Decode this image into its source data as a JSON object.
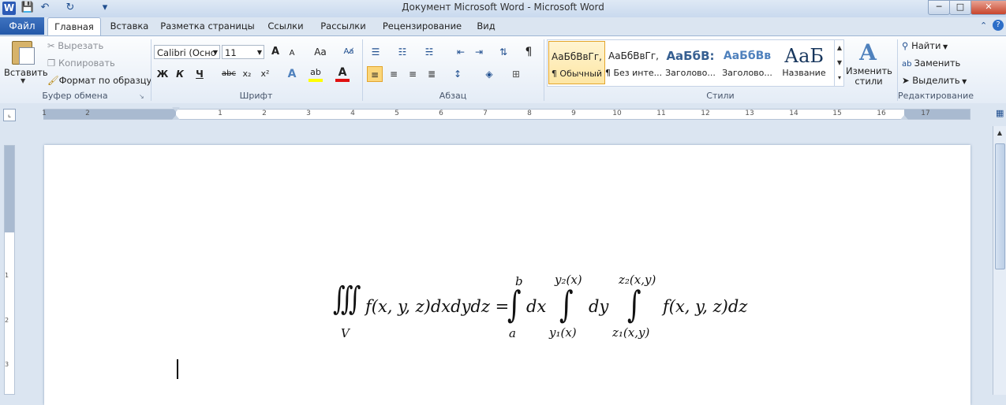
{
  "window": {
    "title": "Документ Microsoft Word  -  Microsoft Word",
    "logo": "W",
    "controls": {
      "minimize": "─",
      "maximize": "□",
      "close": "✕"
    }
  },
  "qat": {
    "save_icon": "💾",
    "undo_icon": "↶",
    "redo_icon": "↻",
    "customize_icon": "▾"
  },
  "tabs": [
    {
      "label": "Файл"
    },
    {
      "label": "Главная"
    },
    {
      "label": "Вставка"
    },
    {
      "label": "Разметка страницы"
    },
    {
      "label": "Ссылки"
    },
    {
      "label": "Рассылки"
    },
    {
      "label": "Рецензирование"
    },
    {
      "label": "Вид"
    }
  ],
  "clipboard": {
    "paste": "Вставить",
    "cut": "Вырезать",
    "copy": "Копировать",
    "format_painter": "Формат по образцу",
    "group": "Буфер обмена"
  },
  "font": {
    "name": "Calibri (Осно",
    "size": "11",
    "grow": "A",
    "shrink": "A",
    "change_case": "Aa",
    "bold": "Ж",
    "italic": "К",
    "underline": "Ч",
    "strike": "abc",
    "subscript": "x₂",
    "superscript": "x²",
    "group": "Шрифт",
    "highlight_color": "#ffff00",
    "font_color": "#e01010"
  },
  "paragraph": {
    "group": "Абзац",
    "pilcrow": "¶"
  },
  "styles": {
    "group": "Стили",
    "items": [
      {
        "preview": "АаБбВвГг,",
        "name": "¶ Обычный"
      },
      {
        "preview": "АаБбВвГг,",
        "name": "¶ Без инте..."
      },
      {
        "preview": "АаБбВ:",
        "name": "Заголово..."
      },
      {
        "preview": "АаБбВв",
        "name": "Заголово..."
      },
      {
        "preview": "АаБ",
        "name": "Название"
      }
    ],
    "change_styles": "Изменить стили"
  },
  "editing": {
    "group": "Редактирование",
    "find": "Найти",
    "replace": "Заменить",
    "select": "Выделить"
  },
  "ruler": {
    "numbers": [
      "1",
      "2",
      "1",
      "2",
      "3",
      "4",
      "5",
      "6",
      "7",
      "8",
      "9",
      "10",
      "11",
      "12",
      "13",
      "14",
      "15",
      "16",
      "17"
    ],
    "vnumbers": [
      "1",
      "1",
      "2",
      "3"
    ]
  },
  "equation": {
    "lhs": "f(x, y, z)dxdydz =",
    "domain": "V",
    "int1_upper": "b",
    "int1_lower": "a",
    "d1": "dx",
    "int2_upper": "y₂(x)",
    "int2_lower": "y₁(x)",
    "d2": "dy",
    "int3_upper": "z₂(x,y)",
    "int3_lower": "z₁(x,y)",
    "rhs": "f(x, y, z)dz",
    "triple_integral": "∭",
    "integral": "∫"
  }
}
